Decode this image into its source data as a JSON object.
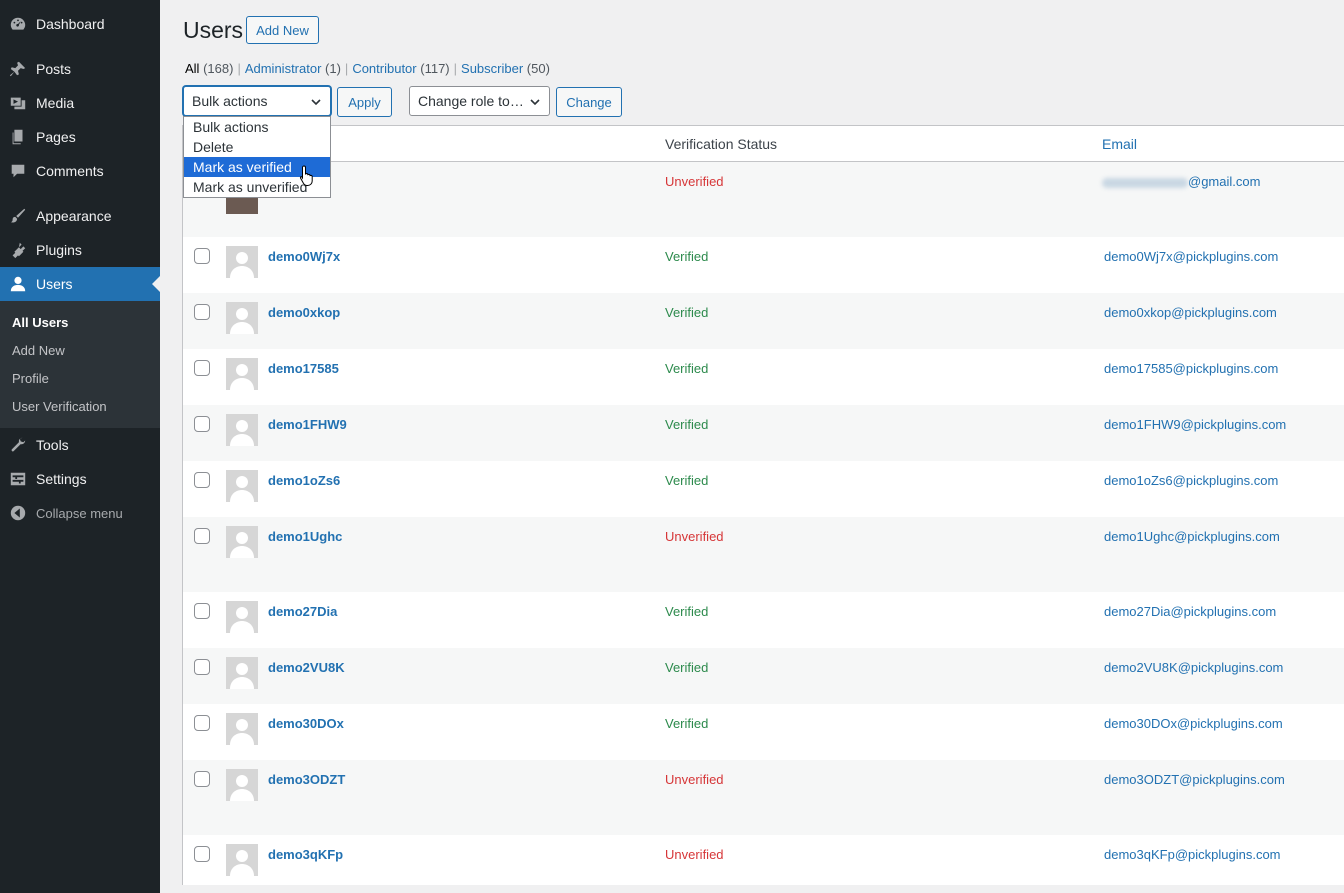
{
  "sidebar": {
    "items": [
      {
        "label": "Dashboard",
        "icon": "dashboard-icon"
      },
      {
        "label": "Posts",
        "icon": "pin-icon"
      },
      {
        "label": "Media",
        "icon": "media-icon"
      },
      {
        "label": "Pages",
        "icon": "page-icon"
      },
      {
        "label": "Comments",
        "icon": "comment-icon"
      },
      {
        "label": "Appearance",
        "icon": "brush-icon"
      },
      {
        "label": "Plugins",
        "icon": "plugin-icon"
      },
      {
        "label": "Users",
        "icon": "user-icon"
      },
      {
        "label": "Tools",
        "icon": "wrench-icon"
      },
      {
        "label": "Settings",
        "icon": "settings-icon"
      },
      {
        "label": "Collapse menu",
        "icon": "collapse-icon"
      }
    ],
    "submenu": [
      "All Users",
      "Add New",
      "Profile",
      "User Verification"
    ]
  },
  "header": {
    "title": "Users",
    "add_new": "Add New"
  },
  "filters": {
    "all": {
      "label": "All",
      "count": "(168)"
    },
    "administrator": {
      "label": "Administrator",
      "count": "(1)"
    },
    "contributor": {
      "label": "Contributor",
      "count": "(117)"
    },
    "subscriber": {
      "label": "Subscriber",
      "count": "(50)"
    },
    "sep": "|"
  },
  "toolbar": {
    "bulk_selected": "Bulk actions",
    "apply": "Apply",
    "role_selected": "Change role to…",
    "change": "Change"
  },
  "dropdown": {
    "options": [
      "Bulk actions",
      "Delete",
      "Mark as verified",
      "Mark as unverified"
    ]
  },
  "table": {
    "columns": {
      "status": "Verification Status",
      "email": "Email"
    },
    "first_row": {
      "status": "Unverified",
      "email_suffix": "@gmail.com"
    },
    "rows": [
      {
        "username": "demo0Wj7x",
        "status": "Verified",
        "email": "demo0Wj7x@pickplugins.com"
      },
      {
        "username": "demo0xkop",
        "status": "Verified",
        "email": "demo0xkop@pickplugins.com"
      },
      {
        "username": "demo17585",
        "status": "Verified",
        "email": "demo17585@pickplugins.com"
      },
      {
        "username": "demo1FHW9",
        "status": "Verified",
        "email": "demo1FHW9@pickplugins.com"
      },
      {
        "username": "demo1oZs6",
        "status": "Verified",
        "email": "demo1oZs6@pickplugins.com"
      },
      {
        "username": "demo1Ughc",
        "status": "Unverified",
        "email": "demo1Ughc@pickplugins.com"
      },
      {
        "username": "demo27Dia",
        "status": "Verified",
        "email": "demo27Dia@pickplugins.com"
      },
      {
        "username": "demo2VU8K",
        "status": "Verified",
        "email": "demo2VU8K@pickplugins.com"
      },
      {
        "username": "demo30DOx",
        "status": "Verified",
        "email": "demo30DOx@pickplugins.com"
      },
      {
        "username": "demo3ODZT",
        "status": "Unverified",
        "email": "demo3ODZT@pickplugins.com"
      },
      {
        "username": "demo3qKFp",
        "status": "Unverified",
        "email": "demo3qKFp@pickplugins.com"
      }
    ]
  }
}
